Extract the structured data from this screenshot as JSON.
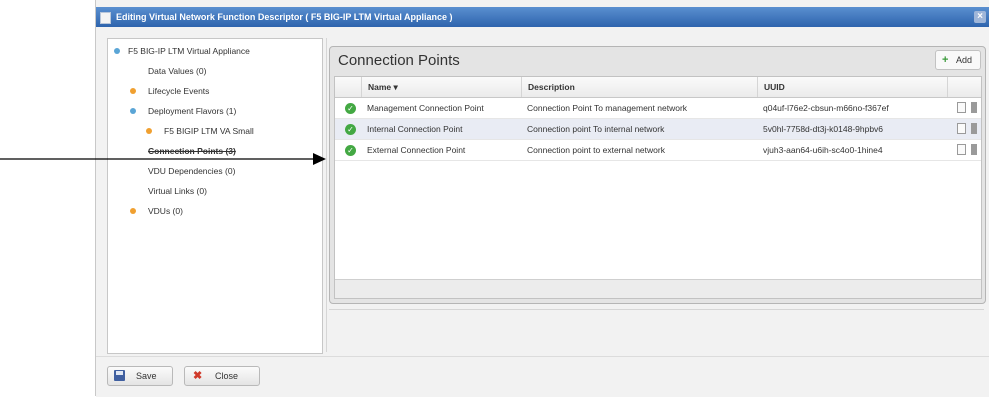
{
  "dialog": {
    "title": "Editing Virtual Network Function Descriptor ( F5 BIG-IP LTM Virtual Appliance )",
    "close_symbol": "×"
  },
  "tree": {
    "root": "F5 BIG-IP LTM Virtual Appliance",
    "items": [
      {
        "label": "Data Values (0)"
      },
      {
        "label": "Lifecycle Events"
      },
      {
        "label": "Deployment Flavors (1)"
      },
      {
        "label": "F5 BIGIP LTM VA Small"
      },
      {
        "label": "Connection Points (3)"
      },
      {
        "label": "VDU Dependencies (0)"
      },
      {
        "label": "Virtual Links (0)"
      },
      {
        "label": "VDUs (0)"
      }
    ]
  },
  "panel": {
    "title": "Connection Points",
    "add_label": "Add",
    "add_symbol": "+"
  },
  "table": {
    "columns": [
      "Name ▾",
      "Description",
      "UUID"
    ],
    "rows": [
      {
        "name": "Management Connection Point",
        "description": "Connection Point To management network",
        "uuid": "q04uf-l76e2-cbsun-m66no-f367ef"
      },
      {
        "name": "Internal Connection Point",
        "description": "Connection point To internal network",
        "uuid": "5v0hl-7758d-dt3j-k0148-9hpbv6"
      },
      {
        "name": "External Connection Point",
        "description": "Connection point to external network",
        "uuid": "vjuh3-aan64-u6ih-sc4o0-1hine4"
      }
    ],
    "status_symbol": "✓"
  },
  "footer": {
    "save_label": "Save",
    "close_label": "Close",
    "close_symbol": "✖"
  },
  "colors": {
    "titlebar": "#2e64ad",
    "status_ok": "#43a843",
    "tree_dot_blue": "#5aa5d6",
    "tree_dot_orange": "#f0a030"
  },
  "icons": [
    "window-icon",
    "close-icon",
    "tree-node-icon",
    "plus-icon",
    "status-ok-icon",
    "edit-icon",
    "delete-icon",
    "save-icon",
    "close-x-icon",
    "arrow-annotation"
  ]
}
